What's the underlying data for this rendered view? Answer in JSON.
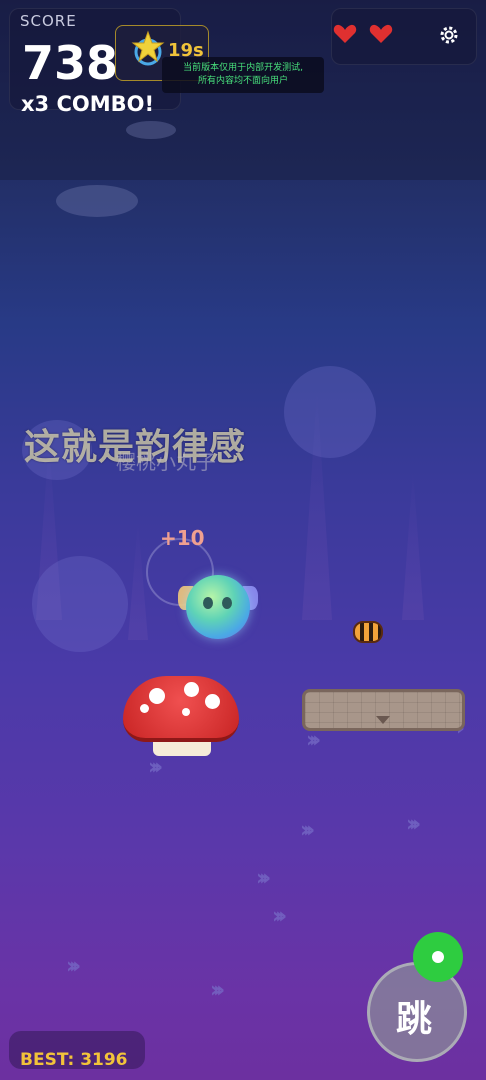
{
  "hud": {
    "score_label": "SCORE",
    "score_value": "738",
    "combo": "x3 COMBO!",
    "timer": "19s",
    "notice_line1": "当前版本仅用于内部开发测试,",
    "notice_line2": "所有内容均不面向用户",
    "lives": 2
  },
  "stage": {
    "rhythm_text": "这就是韵律感",
    "rhythm_sub": "樱桃小丸子",
    "points_popup": "+10"
  },
  "controls": {
    "jump_label": "跳"
  },
  "footer": {
    "best": "BEST: 3196"
  },
  "colors": {
    "accent_gold": "#f0c33a",
    "heart_red": "#e03030",
    "notice_green": "#48e07c",
    "green_button": "#2ecc40"
  },
  "icons": [
    "star-icon",
    "heart-icon",
    "gear-icon"
  ]
}
